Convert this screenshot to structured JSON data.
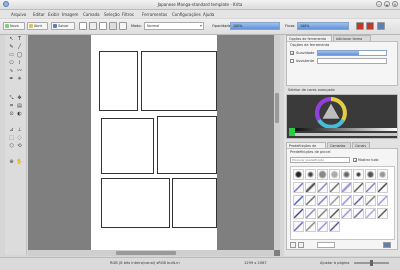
{
  "window": {
    "title": "Japanese Manga-standard template - Krita"
  },
  "menu": [
    "Arquivo",
    "Editar",
    "Exibir",
    "Imagem",
    "Camada",
    "Seleção",
    "Filtros",
    "Ferramentas",
    "Configurações",
    "Ajuda"
  ],
  "toolbar": {
    "new_label": "Novo",
    "open_label": "Abrir",
    "save_label": "Salvar",
    "mode_label": "Modo:",
    "blend_mode": "Normal",
    "opacity_label": "Opacidade:",
    "opacity_value": "100%",
    "flow_label": "Fluxo:",
    "flow_value": "100%"
  },
  "dock": {
    "tool_options_tab": "Opções de ferramenta",
    "add_shape_tab": "Adicionar forma",
    "tool_options_title": "Opções da ferramenta",
    "smoothing_label": "Suavidade",
    "assistant_label": "Assistente",
    "color_selector_title": "Seletor de cores avançado",
    "brush_presets_tab": "Predefinições de pincel",
    "layers_tab": "Camadas",
    "channels_tab": "Canais",
    "brush_presets_title": "Predefinições de pincel",
    "search_placeholder": "Procurar predefinição",
    "show_all_label": "Mostrar tudo"
  },
  "status": {
    "color_profile": "RGB (8 bits inteiro/canal)  sRGB built-in",
    "dimensions": "1299 x 2067",
    "zoom": "Ajustar à página"
  }
}
